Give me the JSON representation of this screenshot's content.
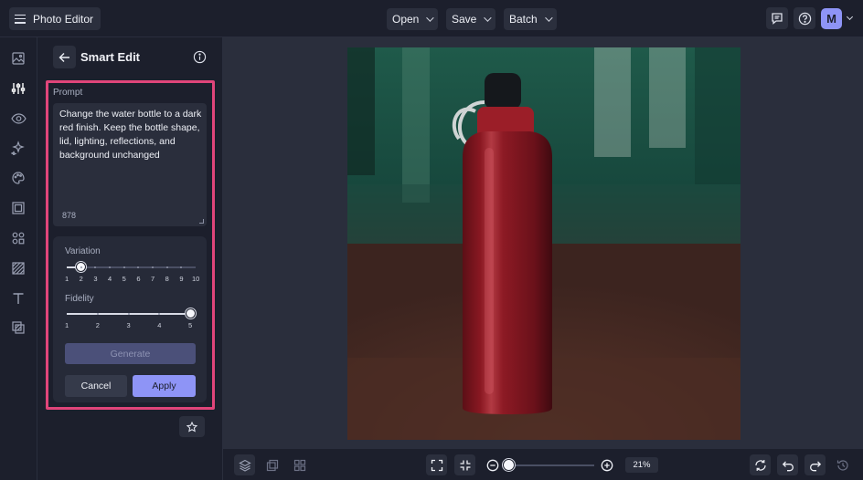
{
  "header": {
    "app_title": "Photo Editor",
    "menus": [
      {
        "label": "Open"
      },
      {
        "label": "Save"
      },
      {
        "label": "Batch"
      }
    ],
    "avatar_initial": "M"
  },
  "panel": {
    "title": "Smart Edit",
    "prompt": {
      "label": "Prompt",
      "value": "Change the water bottle to a dark red finish. Keep the bottle shape, lid, lighting, reflections, and background unchanged",
      "char_count": "878"
    },
    "variation": {
      "label": "Variation",
      "ticks": [
        "1",
        "2",
        "3",
        "4",
        "5",
        "6",
        "7",
        "8",
        "9",
        "10"
      ],
      "value": 2
    },
    "fidelity": {
      "label": "Fidelity",
      "ticks": [
        "1",
        "2",
        "3",
        "4",
        "5"
      ],
      "value": 5
    },
    "generate_label": "Generate",
    "cancel_label": "Cancel",
    "apply_label": "Apply"
  },
  "toolbar": {
    "zoom_percent": "21%",
    "zoom_fraction": 0.05
  },
  "colors": {
    "accent": "#8e94f6",
    "highlight": "#e0457a",
    "bottle": "#8a1822"
  }
}
